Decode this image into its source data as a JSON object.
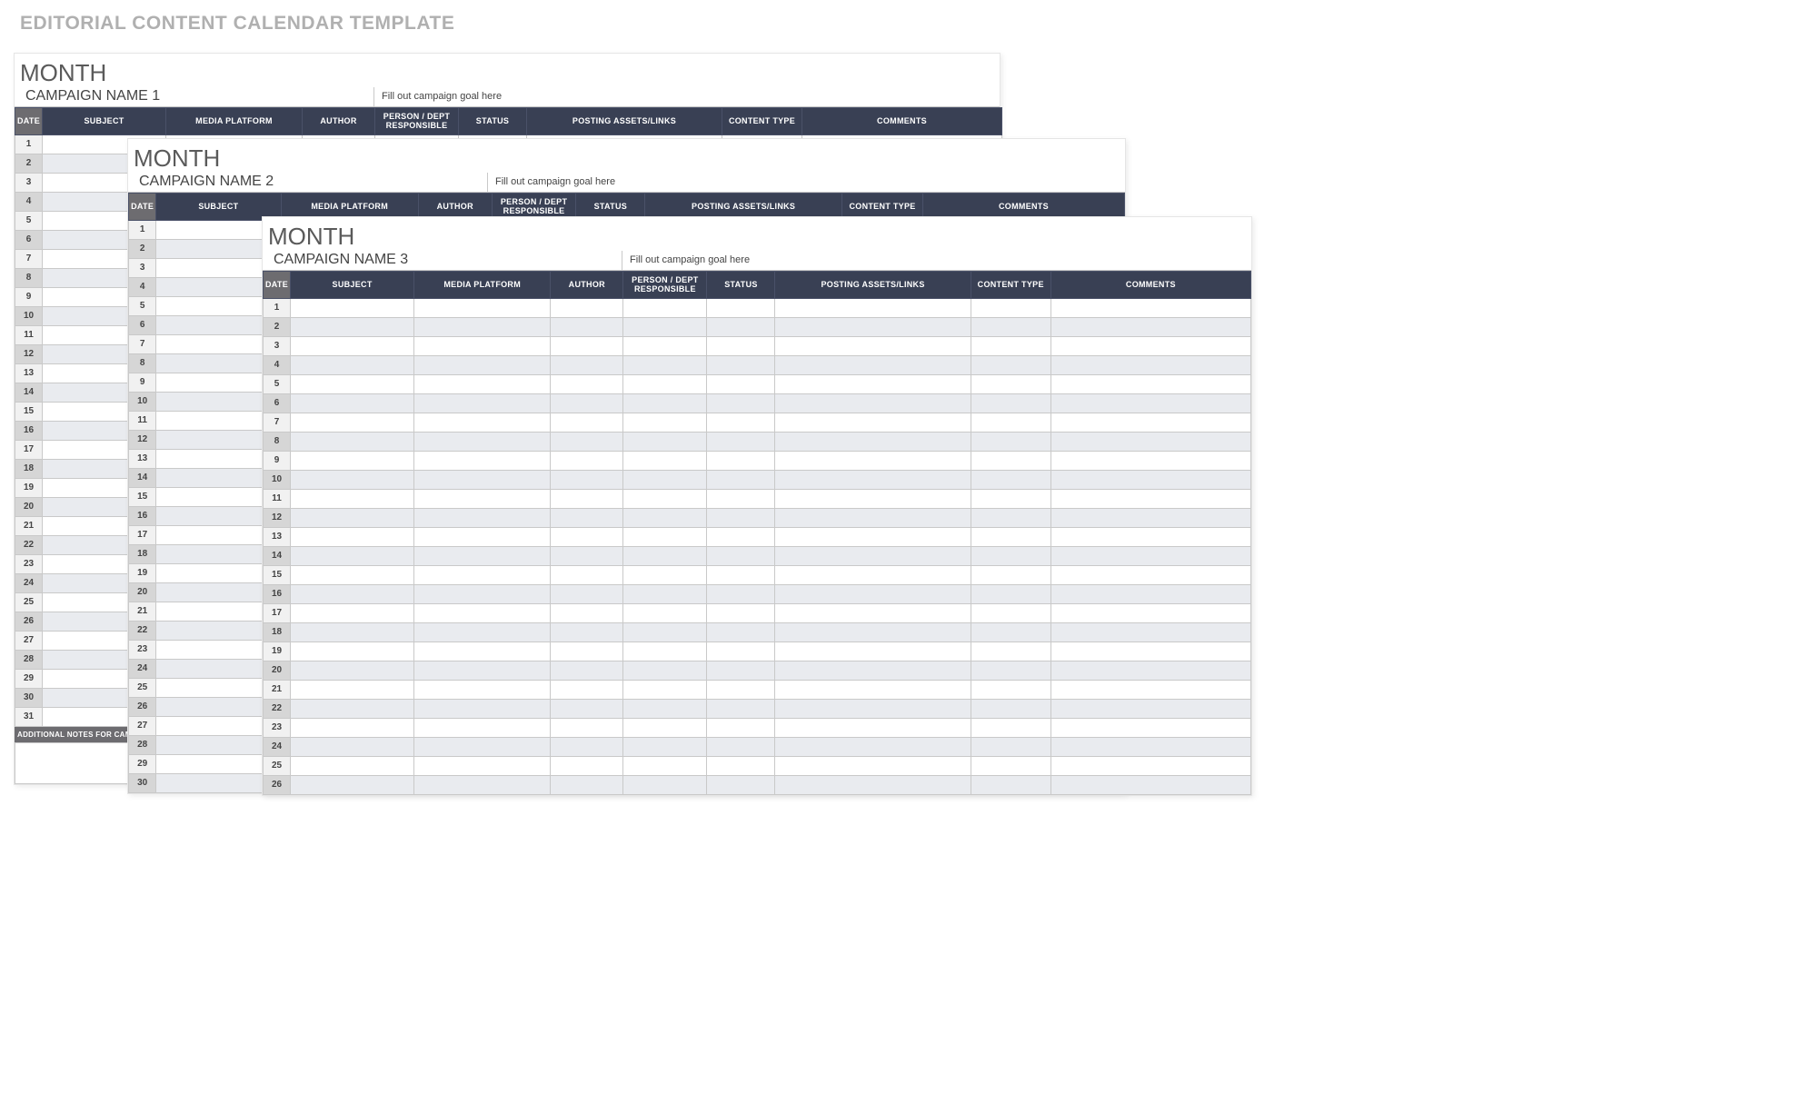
{
  "page_title": "EDITORIAL CONTENT CALENDAR TEMPLATE",
  "columns": [
    "DATE",
    "SUBJECT",
    "MEDIA PLATFORM",
    "AUTHOR",
    "PERSON / DEPT RESPONSIBLE",
    "STATUS",
    "POSTING ASSETS/LINKS",
    "CONTENT TYPE",
    "COMMENTS"
  ],
  "sheets": [
    {
      "month_label": "MONTH",
      "campaign_name": "CAMPAIGN NAME 1",
      "campaign_goal": "Fill out campaign goal here",
      "row_count": 31,
      "notes_header": "ADDITIONAL NOTES FOR CAMPAIGN"
    },
    {
      "month_label": "MONTH",
      "campaign_name": "CAMPAIGN NAME 2",
      "campaign_goal": "Fill out campaign goal here",
      "row_count": 30,
      "notes_header": ""
    },
    {
      "month_label": "MONTH",
      "campaign_name": "CAMPAIGN NAME 3",
      "campaign_goal": "Fill out campaign goal here",
      "row_count": 26,
      "notes_header": ""
    }
  ]
}
